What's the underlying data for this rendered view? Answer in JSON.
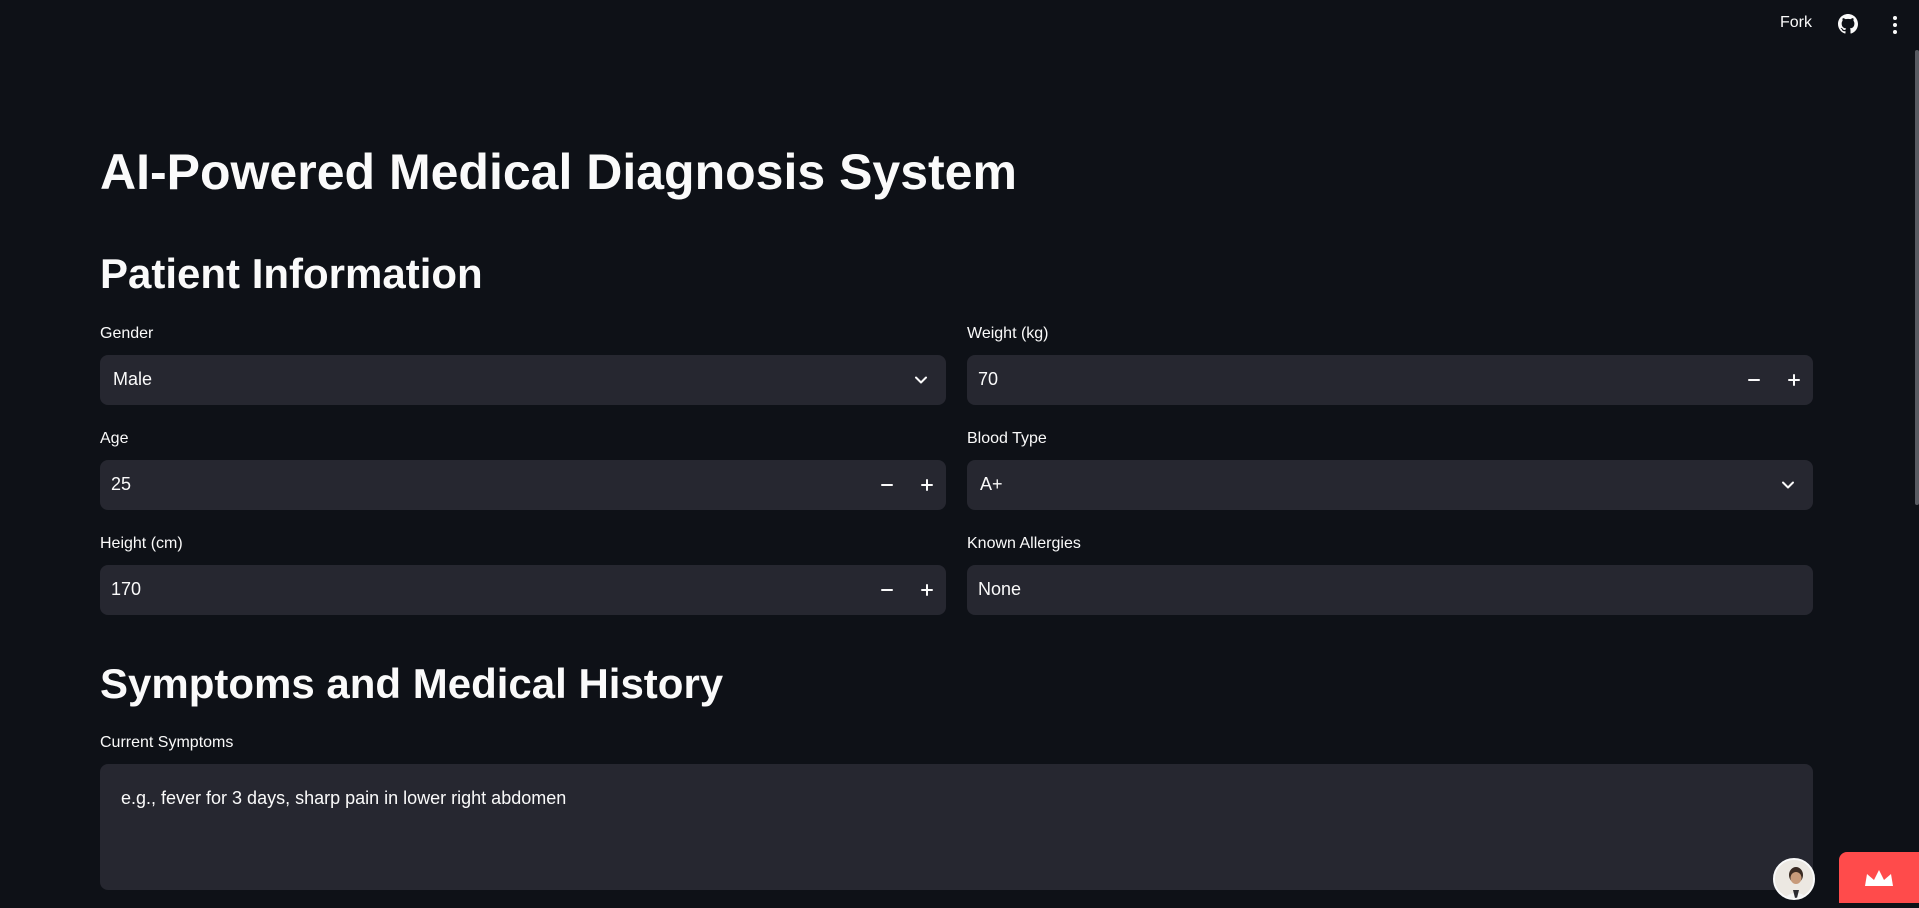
{
  "header": {
    "fork_label": "Fork",
    "github_icon": "github-icon",
    "menu_icon": "more-vertical-icon"
  },
  "page": {
    "title": "AI-Powered Medical Diagnosis System"
  },
  "patient_section": {
    "heading": "Patient Information",
    "gender": {
      "label": "Gender",
      "value": "Male"
    },
    "age": {
      "label": "Age",
      "value": "25"
    },
    "height": {
      "label": "Height (cm)",
      "value": "170"
    },
    "weight": {
      "label": "Weight (kg)",
      "value": "70"
    },
    "blood_type": {
      "label": "Blood Type",
      "value": "A+"
    },
    "allergies": {
      "label": "Known Allergies",
      "value": "None"
    },
    "stepper": {
      "minus": "−",
      "plus": "+"
    }
  },
  "symptoms_section": {
    "heading": "Symptoms and Medical History",
    "current_symptoms": {
      "label": "Current Symptoms",
      "placeholder": "e.g., fever for 3 days, sharp pain in lower right abdomen"
    }
  },
  "colors": {
    "background": "#0e1117",
    "input_bg": "#262730",
    "text": "#fafafa",
    "accent": "#ff4b4b"
  }
}
